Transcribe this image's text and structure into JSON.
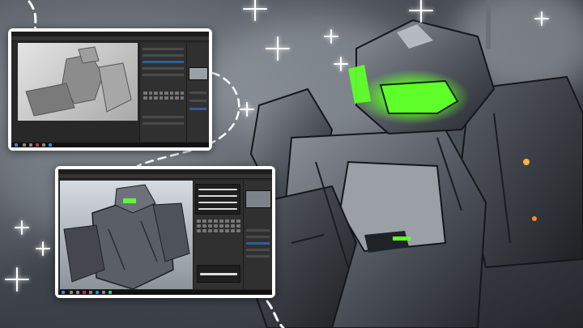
{
  "scene": {
    "accent_green": "#5fff2a",
    "frame_color": "#ffffff",
    "background_tone": "#5d626b"
  },
  "screenshots": [
    {
      "id": "top",
      "app": "photoshop",
      "canvas_stage": "blockout-gray-shapes",
      "taskbar_icons": 10
    },
    {
      "id": "bottom",
      "app": "photoshop",
      "canvas_stage": "detailed-gray-mech",
      "taskbar_icons": 12
    }
  ],
  "icons": [
    "sparkle-icon",
    "green-visor-light"
  ]
}
